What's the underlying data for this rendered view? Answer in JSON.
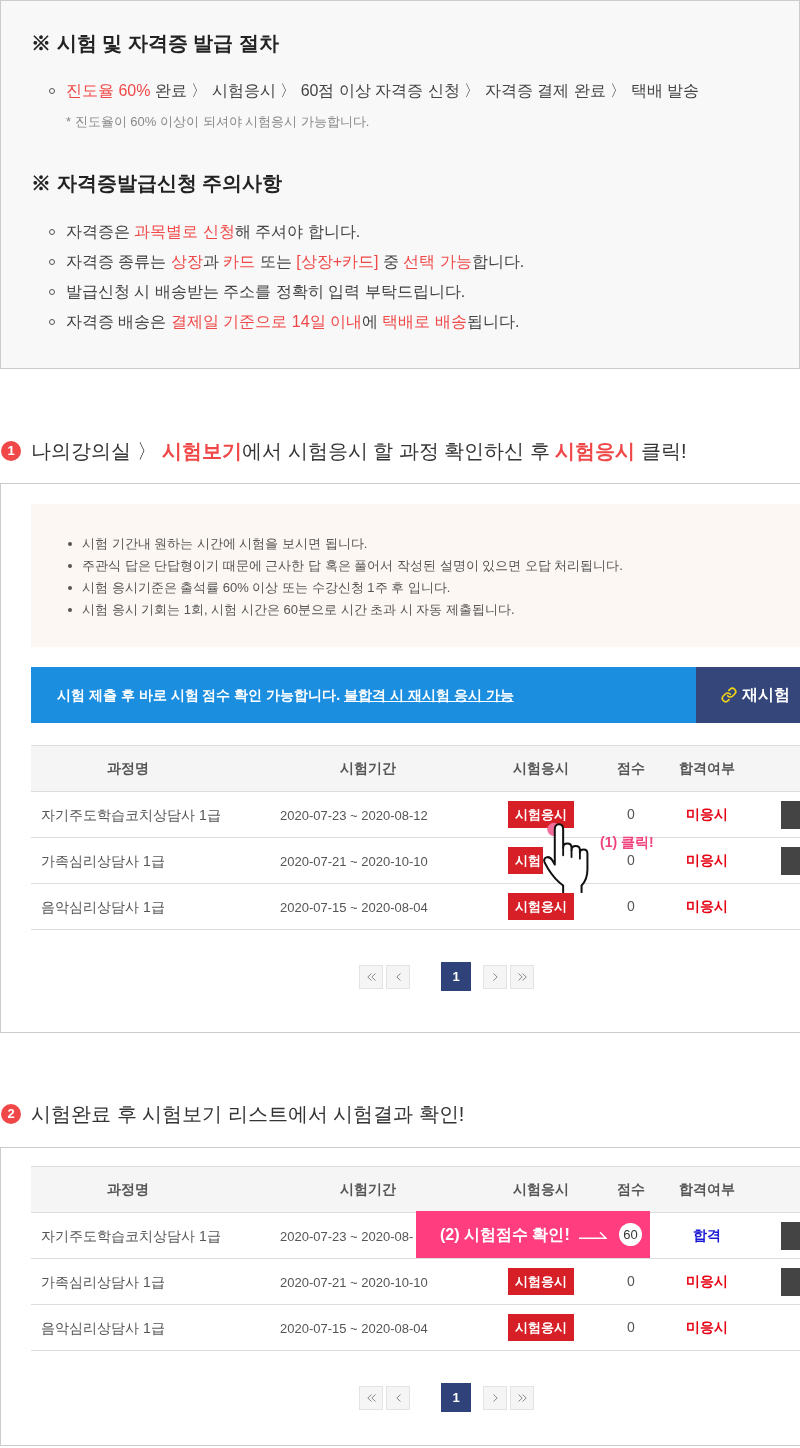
{
  "procedure": {
    "title": "※ 시험 및 자격증 발급 절차",
    "steps": [
      {
        "parts": [
          {
            "text": "진도율 60%",
            "highlight": true
          },
          {
            "text": " 완료 〉 시험응시 〉 60점 이상 자격증 신청 〉 자격증 결제 완료 〉 택배 발송",
            "highlight": false
          }
        ]
      }
    ],
    "note": "* 진도율이 60% 이상이 되셔야 시험응시 가능합니다."
  },
  "cautions": {
    "title": "※ 자격증발급신청 주의사항",
    "items": [
      {
        "parts": [
          {
            "text": "자격증은 ",
            "highlight": false
          },
          {
            "text": "과목별로 신청",
            "highlight": true
          },
          {
            "text": "해 주셔야 합니다.",
            "highlight": false
          }
        ]
      },
      {
        "parts": [
          {
            "text": "자격증 종류는 ",
            "highlight": false
          },
          {
            "text": "상장",
            "highlight": true
          },
          {
            "text": "과 ",
            "highlight": false
          },
          {
            "text": "카드",
            "highlight": true
          },
          {
            "text": " 또는 ",
            "highlight": false
          },
          {
            "text": "[상장+카드]",
            "highlight": true
          },
          {
            "text": " 중 ",
            "highlight": false
          },
          {
            "text": "선택 가능",
            "highlight": true
          },
          {
            "text": "합니다.",
            "highlight": false
          }
        ]
      },
      {
        "parts": [
          {
            "text": "발급신청 시 배송받는 주소를 정확히 입력 부탁드립니다.",
            "highlight": false
          }
        ]
      },
      {
        "parts": [
          {
            "text": "자격증 배송은 ",
            "highlight": false
          },
          {
            "text": "결제일 기준으로 14일 이내",
            "highlight": true
          },
          {
            "text": "에 ",
            "highlight": false
          },
          {
            "text": "택배로 배송",
            "highlight": true
          },
          {
            "text": "됩니다.",
            "highlight": false
          }
        ]
      }
    ]
  },
  "step_1": {
    "number": "1",
    "heading": [
      {
        "text": "나의강의실 〉 ",
        "highlight": false
      },
      {
        "text": "시험보기",
        "highlight": true
      },
      {
        "text": "에서 시험응시 할 과정 확인하신 후 ",
        "highlight": false
      },
      {
        "text": "시험응시",
        "highlight": true
      },
      {
        "text": " 클릭!",
        "highlight": false
      }
    ],
    "notices": [
      "시험 기간내 원하는 시간에 시험을 보시면 됩니다.",
      "주관식 답은 단답형이기 때문에 근사한 답 혹은 풀어서 작성된 설명이 있으면 오답 처리됩니다.",
      "시험 응시기준은 출석률 60% 이상 또는 수강신청 1주 후 입니다.",
      "시험 응시 기회는 1회, 시험 시간은 60분으로 시간 초과 시 자동 제출됩니다."
    ],
    "banner": {
      "text": "시험 제출 후 바로 시험 점수 확인 가능합니다.",
      "link": "불합격 시 재시험 응시 가능",
      "button": "재시험"
    },
    "table": {
      "columns": [
        "과정명",
        "시험기간",
        "시험응시",
        "점수",
        "합격여부"
      ],
      "rows": [
        {
          "course": "자기주도학습코치상담사 1급",
          "period": "2020-07-23 ~ 2020-08-12",
          "exam_button": "시험응시",
          "score": "0",
          "result": "미응시",
          "color": "#e60012",
          "retake_button": true,
          "callout": {
            "kind": "tap",
            "text": "(1) 클릭!"
          }
        },
        {
          "course": "가족심리상담사 1급",
          "period": "2020-07-21 ~ 2020-10-10",
          "exam_button": "시험",
          "score": "0",
          "result": "미응시",
          "color": "#e60012",
          "retake_button": true
        },
        {
          "course": "음악심리상담사 1급",
          "period": "2020-07-15 ~ 2020-08-04",
          "exam_button": "시험응시",
          "score": "0",
          "result": "미응시",
          "color": "#e60012",
          "retake_button": false
        }
      ]
    },
    "pagination": [
      {
        "label": "1",
        "selected": true
      }
    ]
  },
  "step_2": {
    "number": "2",
    "heading": [
      {
        "text": "시험완료 후 시험보기 리스트에서 시험결과 확인!",
        "highlight": false
      }
    ],
    "table": {
      "columns": [
        "과정명",
        "시험기간",
        "시험응시",
        "점수",
        "합격여부"
      ],
      "rows": [
        {
          "course": "자기주도학습코치상담사 1급",
          "period": "2020-07-23 ~ 2020-08-",
          "score": "60",
          "result": "합격",
          "color": "#1a1ad6",
          "retake_button": true,
          "callout": {
            "kind": "score_banner",
            "text": "(2) 시험점수 확인!"
          }
        },
        {
          "course": "가족심리상담사 1급",
          "period": "2020-07-21 ~ 2020-10-10",
          "exam_button": "시험응시",
          "score": "0",
          "result": "미응시",
          "color": "#e60012",
          "retake_button": true
        },
        {
          "course": "음악심리상담사 1급",
          "period": "2020-07-15 ~ 2020-08-04",
          "exam_button": "시험응시",
          "score": "0",
          "result": "미응시",
          "color": "#e60012",
          "retake_button": false
        }
      ]
    },
    "pagination": [
      {
        "label": "1",
        "selected": true
      }
    ]
  }
}
